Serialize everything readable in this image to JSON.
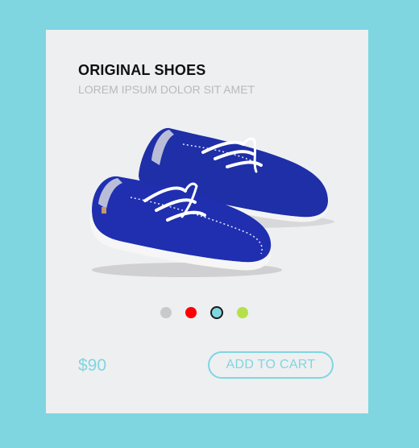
{
  "product": {
    "title": "ORIGINAL SHOES",
    "subtitle": "LOREM IPSUM DOLOR SIT AMET",
    "price": "$90",
    "image_icon": "blue-boat-shoes-image"
  },
  "color_options": [
    {
      "name": "gray",
      "color": "#c8c9cb",
      "selected": false
    },
    {
      "name": "red",
      "color": "#ff0000",
      "selected": false
    },
    {
      "name": "teal",
      "color": "#7fd6e0",
      "selected": true
    },
    {
      "name": "green",
      "color": "#b5e04a",
      "selected": false
    }
  ],
  "actions": {
    "add_to_cart_label": "ADD TO CART"
  },
  "colors": {
    "background": "#7fd6e0",
    "card": "#eeeff1",
    "accent": "#7fd6e0",
    "shoe": "#1e2fa8"
  }
}
